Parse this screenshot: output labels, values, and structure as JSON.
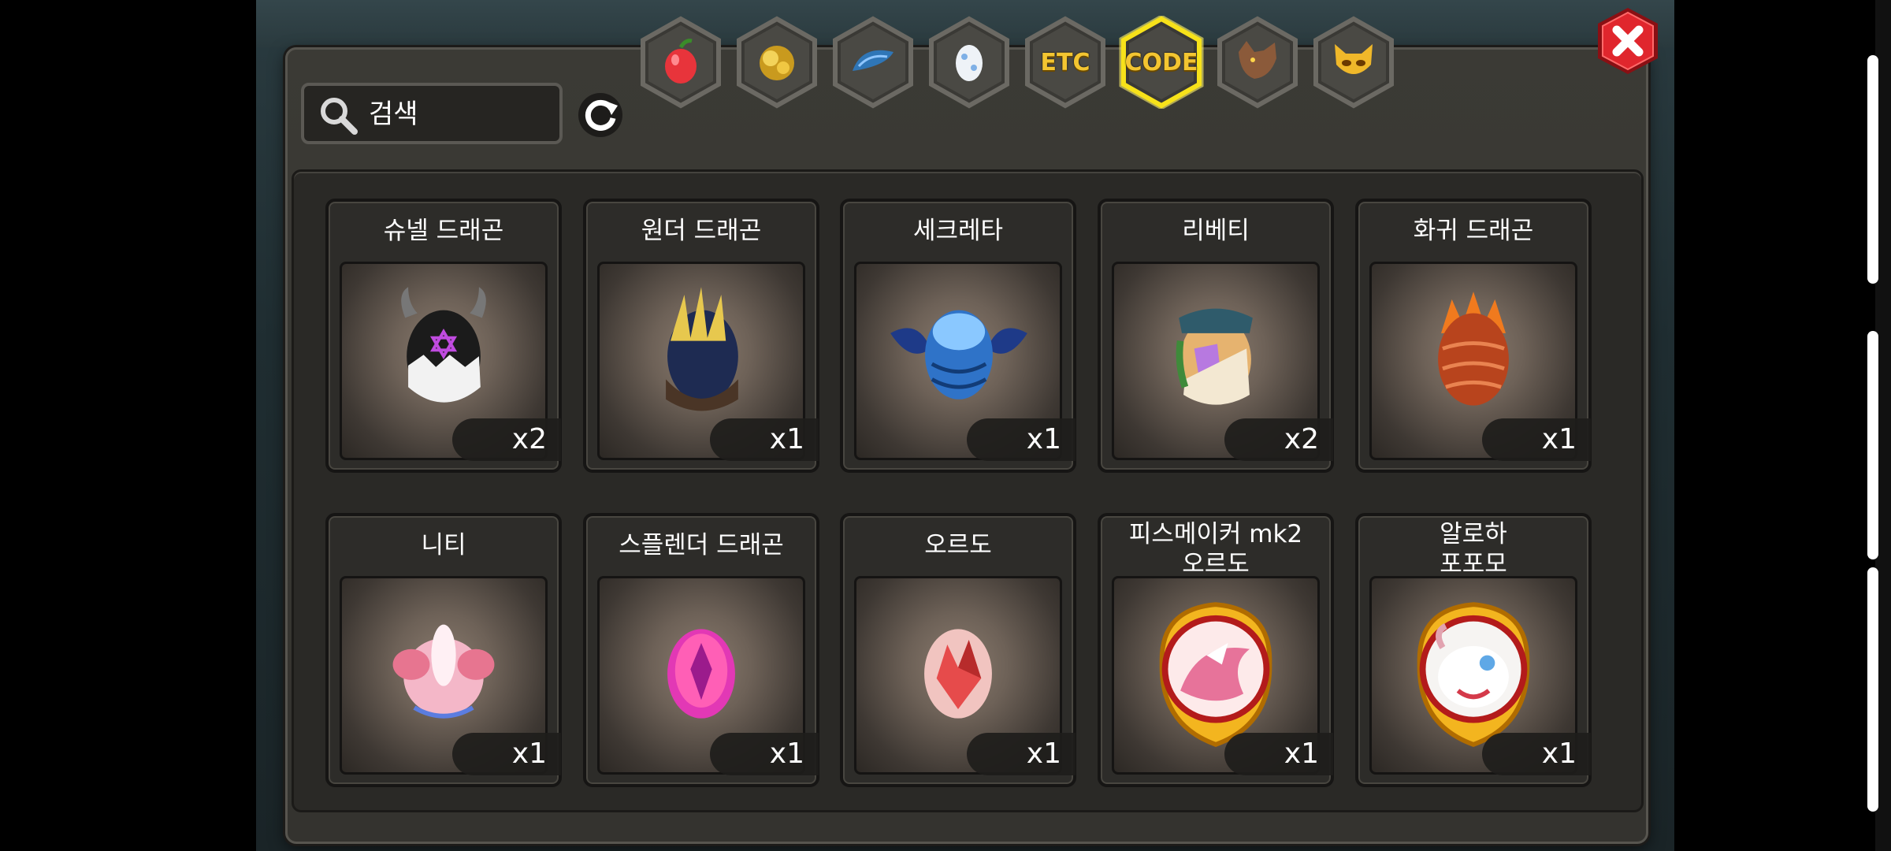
{
  "search": {
    "placeholder": "검색",
    "value": ""
  },
  "tabs": [
    {
      "icon": "fruit-icon"
    },
    {
      "icon": "gold-ore-icon"
    },
    {
      "icon": "dragon-scale-icon"
    },
    {
      "icon": "egg-icon"
    },
    {
      "label": "ETC"
    },
    {
      "label": "CODE",
      "selected": true
    },
    {
      "icon": "wolf-icon"
    },
    {
      "icon": "horned-mask-icon"
    }
  ],
  "items": [
    {
      "name": "슈넬 드래곤",
      "qty": "x2",
      "icon": "schnell-dragon-egg-icon"
    },
    {
      "name": "원더 드래곤",
      "qty": "x1",
      "icon": "wonder-dragon-egg-icon"
    },
    {
      "name": "세크레타",
      "qty": "x1",
      "icon": "secreta-egg-icon"
    },
    {
      "name": "리베티",
      "qty": "x2",
      "icon": "liberty-egg-icon"
    },
    {
      "name": "화귀 드래곤",
      "qty": "x1",
      "icon": "flame-dragon-egg-icon"
    },
    {
      "name": "니티",
      "qty": "x1",
      "icon": "niti-egg-icon"
    },
    {
      "name": "스플렌더 드래곤",
      "qty": "x1",
      "icon": "splendor-dragon-egg-icon"
    },
    {
      "name": "오르도",
      "qty": "x1",
      "icon": "ordo-egg-icon"
    },
    {
      "name1": "피스메이커 mk2",
      "name2": "오르도",
      "qty": "x1",
      "icon": "peacemaker-ordo-medal-icon"
    },
    {
      "name1": "알로하",
      "name2": "포포모",
      "qty": "x1",
      "icon": "aloha-popomo-medal-icon"
    }
  ],
  "colors": {
    "accent": "#f3c531",
    "close": "#d81f26",
    "panel": "#3b3a35"
  }
}
